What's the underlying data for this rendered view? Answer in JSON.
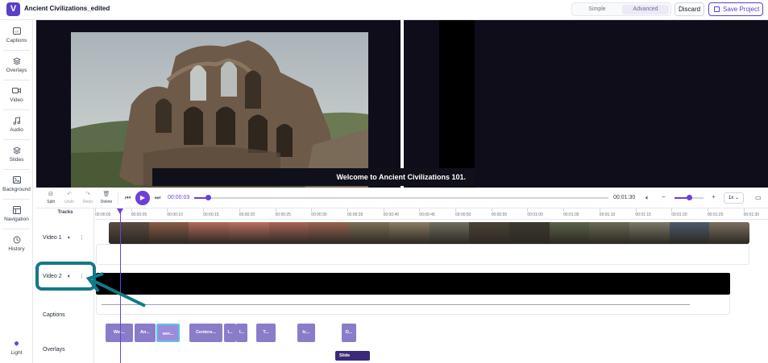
{
  "app": {
    "logo_letter": "V",
    "title": "Ancient Civilizations_edited",
    "mode_simple": "Simple",
    "mode_advanced": "Advanced",
    "discard_label": "Discard",
    "save_label": "Save Project",
    "active_mode": "advanced",
    "accent_color": "#6d3fd8",
    "annotation_color": "#127987"
  },
  "sidebar": {
    "items": [
      {
        "label": "Captions",
        "icon": "captions-icon"
      },
      {
        "label": "Overlays",
        "icon": "layers-icon"
      },
      {
        "label": "Video",
        "icon": "video-icon"
      },
      {
        "label": "Audio",
        "icon": "music-icon"
      },
      {
        "label": "Slides",
        "icon": "stack-icon"
      },
      {
        "label": "Background",
        "icon": "image-icon"
      },
      {
        "label": "Navigation",
        "icon": "navigation-icon"
      },
      {
        "label": "History",
        "icon": "history-icon"
      }
    ],
    "theme_label": "Light",
    "theme_icon": "sun-icon"
  },
  "preview": {
    "caption_text": "Welcome to Ancient Civilizations 101."
  },
  "controls": {
    "split_label": "Split",
    "undo_label": "Undo",
    "redo_label": "Redo",
    "delete_label": "Delete",
    "current_time": "00:00:03",
    "total_time": "00:01:30",
    "progress_fraction": 0.033,
    "volume_fraction": 0.5,
    "speed": "1x"
  },
  "timeline": {
    "tracks_header": "Tracks",
    "ticks": [
      "00:00:00",
      "00:00:05",
      "00:00:10",
      "00:00:15",
      "00:00:20",
      "00:00:25",
      "00:00:30",
      "00:00:35",
      "00:00:40",
      "00:00:45",
      "00:00:50",
      "00:00:55",
      "00:01:00",
      "00:01:05",
      "00:01:10",
      "00:01:15",
      "00:01:20",
      "00:01:25",
      "00:01:30"
    ],
    "tracks": {
      "video1": "Video 1",
      "video2": "Video 2",
      "captions": "Captions",
      "overlays": "Overlays"
    },
    "caption_clips": [
      {
        "label": "Wel..."
      },
      {
        "label": "An..."
      },
      {
        "label": "wer...",
        "selected": true
      },
      {
        "label": "Centers..."
      },
      {
        "label": "I..."
      },
      {
        "label": "I..."
      },
      {
        "label": "T..."
      },
      {
        "label": "Ic..."
      },
      {
        "label": "O..."
      }
    ],
    "overlay_clip": "Slide"
  }
}
